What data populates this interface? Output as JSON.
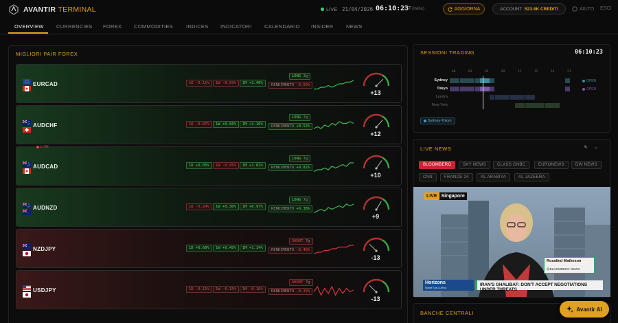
{
  "header": {
    "brand": "AVANTIR",
    "brand_accent": "TERMINAL",
    "live_label": "LIVE",
    "date": "21/04/2026",
    "time": "06:10:23",
    "timezone": "CET",
    "timezone_sub": "(Italia)",
    "refresh_label": "AGGIORNA",
    "account_label": "ACCOUNT",
    "account_credits": "523.8K CREDITI",
    "help_label": "AIUTO",
    "exit_label": "ESCI"
  },
  "tabs": [
    {
      "label": "OVERVIEW",
      "active": true
    },
    {
      "label": "CURRENCIES"
    },
    {
      "label": "FOREX"
    },
    {
      "label": "COMMODITIES"
    },
    {
      "label": "INDICES"
    },
    {
      "label": "INDICATORI"
    },
    {
      "label": "CALENDARIO"
    },
    {
      "label": "INSIDER"
    },
    {
      "label": "NEWS"
    }
  ],
  "forex": {
    "title": "MIGLIORI PAIR FOREX",
    "yield_label": "RENDIMENTO",
    "pairs": [
      {
        "name": "EURCAD",
        "flags": [
          "EU",
          "CA"
        ],
        "d1": "1D -0.11%",
        "w1": "1W -0.93%",
        "m1": "1M +1.40%",
        "d1_up": false,
        "w1_up": false,
        "m1_up": true,
        "side": "LONG",
        "duration": "3g",
        "yield": "-0.50%",
        "yield_up": false,
        "score": "+13",
        "score_value": 13,
        "trend": "pos",
        "spark": [
          7,
          7,
          6,
          6,
          5,
          6,
          5,
          4,
          4,
          3,
          3,
          2
        ]
      },
      {
        "name": "AUDCHF",
        "flags": [
          "AU",
          "CH"
        ],
        "d1": "1D -0.07%",
        "w1": "1W +0.56%",
        "m1": "1M +1.16%",
        "d1_up": false,
        "w1_up": true,
        "m1_up": true,
        "side": "LONG",
        "duration": "7g",
        "yield": "+0.52%",
        "yield_up": true,
        "score": "+12",
        "score_value": 12,
        "trend": "pos",
        "spark": [
          6,
          5,
          6,
          4,
          5,
          3,
          4,
          2,
          3,
          3,
          2,
          3
        ]
      },
      {
        "name": "AUDCAD",
        "flags": [
          "AU",
          "CA"
        ],
        "d1": "1D +0.05%",
        "w1": "1W -0.05%",
        "m1": "1M +1.82%",
        "d1_up": true,
        "w1_up": false,
        "m1_up": true,
        "side": "LONG",
        "duration": "7g",
        "yield": "+0.82%",
        "yield_up": true,
        "score": "+10",
        "score_value": 10,
        "trend": "pos",
        "spark": [
          7,
          6,
          6,
          5,
          6,
          4,
          5,
          4,
          3,
          4,
          2,
          2
        ]
      },
      {
        "name": "AUDNZD",
        "flags": [
          "AU",
          "NZ"
        ],
        "d1": "1D -0.24%",
        "w1": "1W +0.36%",
        "m1": "1M +0.97%",
        "d1_up": false,
        "w1_up": true,
        "m1_up": true,
        "side": "LONG",
        "duration": "7g",
        "yield": "+0.38%",
        "yield_up": true,
        "score": "+9",
        "score_value": 9,
        "trend": "pos",
        "spark": [
          7,
          6,
          5,
          6,
          4,
          5,
          4,
          3,
          4,
          2,
          3,
          2
        ]
      },
      {
        "name": "NZDJPY",
        "flags": [
          "NZ",
          "JP"
        ],
        "d1": "1D +0.60%",
        "w1": "1W +0.45%",
        "m1": "1M +1.14%",
        "d1_up": true,
        "w1_up": true,
        "m1_up": true,
        "side": "SHORT",
        "duration": "7g",
        "yield": "-0.40%",
        "yield_up": false,
        "score": "-13",
        "score_value": -13,
        "trend": "neg",
        "spark": [
          7,
          6,
          6,
          5,
          5,
          4,
          4,
          3,
          3,
          3,
          2,
          2
        ]
      },
      {
        "name": "USDJPY",
        "flags": [
          "US",
          "JP"
        ],
        "d1": "1D -0.11%",
        "w1": "1W -0.15%",
        "m1": "1M -0.16%",
        "d1_up": false,
        "w1_up": false,
        "m1_up": false,
        "side": "SHORT",
        "duration": "7g",
        "yield": "-0.19%",
        "yield_up": false,
        "score": "-13",
        "score_value": -13,
        "trend": "neg",
        "spark": [
          5,
          2,
          7,
          3,
          6,
          2,
          7,
          3,
          6,
          3,
          5,
          4
        ]
      }
    ]
  },
  "sessions": {
    "title": "SESSIONI TRADING",
    "time": "06:10:23",
    "hours": [
      "00",
      "03",
      "06",
      "09",
      "12",
      "15",
      "18",
      "21"
    ],
    "rows": [
      {
        "label": "Sydney",
        "status": "OPEN",
        "active": true,
        "color": "#2a4a52",
        "highlight": "#3f8aa0",
        "from": 0,
        "to": 9
      },
      {
        "label": "Tokyo",
        "status": "OPEN",
        "active": true,
        "color": "#4a3a6a",
        "highlight": "#7a5aa8",
        "from": 0,
        "to": 9
      },
      {
        "label": "Londra",
        "status": "",
        "active": false,
        "color": "#252f45",
        "from": 8,
        "to": 17
      },
      {
        "label": "New York",
        "status": "",
        "active": false,
        "color": "#293c2a",
        "from": 13,
        "to": 22
      }
    ],
    "overlap": "Sydney-Tokyo"
  },
  "news": {
    "title": "LIVE NEWS",
    "live_label": "LIVE",
    "channels": [
      {
        "label": "BLOOMBERG",
        "active": true
      },
      {
        "label": "SKY NEWS"
      },
      {
        "label": "CLASS CNBC"
      },
      {
        "label": "EURONEWS"
      },
      {
        "label": "DW NEWS"
      },
      {
        "label": "CNN"
      },
      {
        "label": "FRANCE 24"
      },
      {
        "label": "AL ARABIYA"
      },
      {
        "label": "AL JAZEERA"
      }
    ],
    "video": {
      "live_tag": "LIVE",
      "location": "Singapore",
      "anchor_name": "Rosalind Matheson",
      "anchor_outlet": "@BLOOMBERG NEWS",
      "show": "Horizons",
      "show_sub": "Middle East & Africa",
      "headline": "IRAN'S GHALIBAF: DON'T ACCEPT NEGOTIATIONS UNDER THREATS"
    }
  },
  "central_banks": {
    "title": "BANCHE CENTRALI"
  },
  "ai_button": {
    "label": "Avantir AI"
  }
}
